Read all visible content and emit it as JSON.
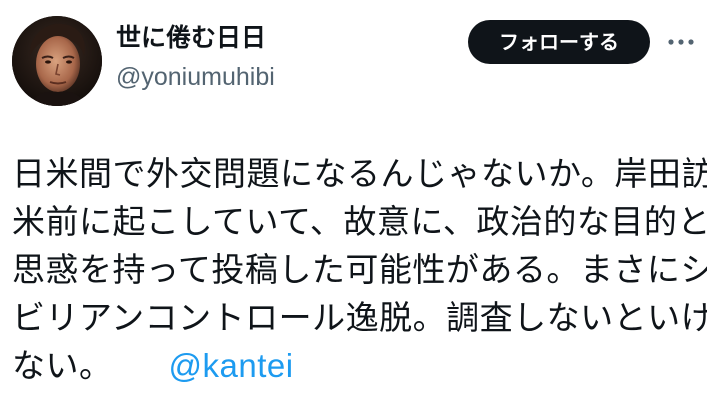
{
  "author": {
    "display_name": "世に倦む日日",
    "handle": "@yoniumuhibi"
  },
  "actions": {
    "follow_label": "フォローする",
    "more_icon": "more-horizontal-icon"
  },
  "tweet": {
    "lines": [
      "日米間で外交問題になるんじゃないか。岸田訪",
      "米前に起こしていて、故意に、政治的な目的と",
      "思惑を持って投稿した可能性がある。まさにシ",
      "ビリアンコントロール逸脱。調査しないといけ",
      "ない。"
    ],
    "mention": "@kantei"
  },
  "colors": {
    "text": "#0f1419",
    "secondary": "#536471",
    "link": "#1d9bf0",
    "button_bg": "#0f1419",
    "button_text": "#ffffff"
  }
}
